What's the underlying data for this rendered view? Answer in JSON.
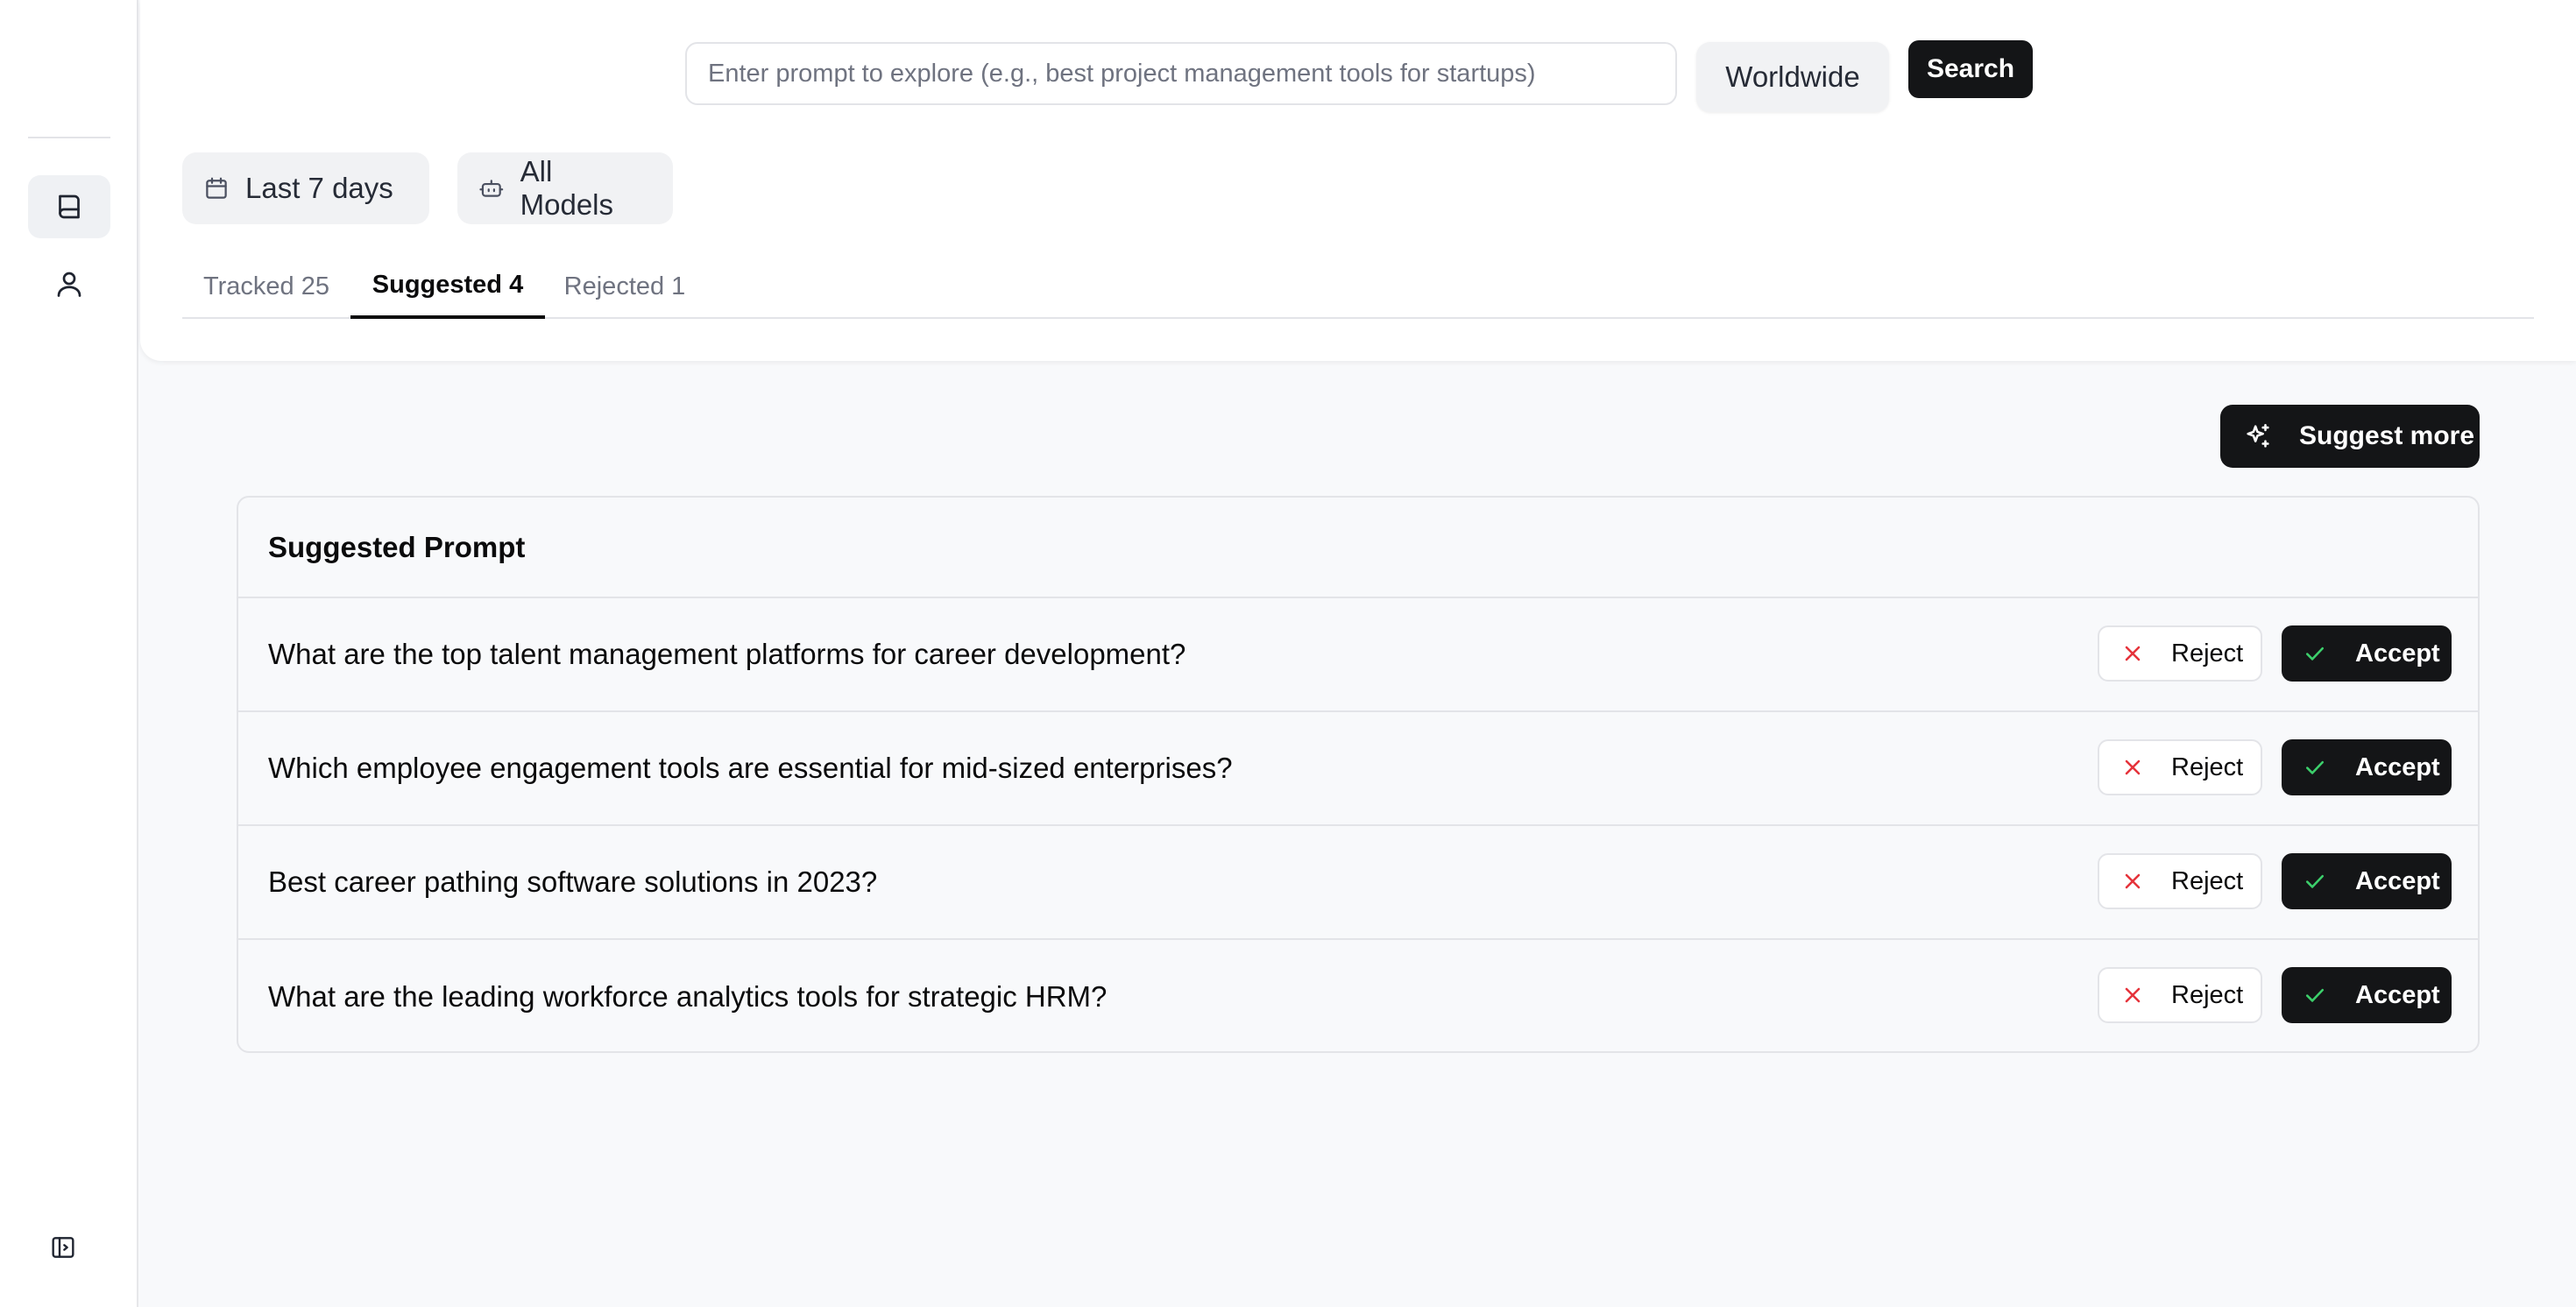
{
  "search": {
    "placeholder": "Enter prompt to explore (e.g., best project management tools for startups)",
    "region": "Worldwide",
    "button_label": "Search"
  },
  "filters": {
    "date_range": "Last 7 days",
    "models": "All Models"
  },
  "tabs": [
    {
      "label": "Tracked 25",
      "active": false
    },
    {
      "label": "Suggested 4",
      "active": true
    },
    {
      "label": "Rejected 1",
      "active": false
    }
  ],
  "actions": {
    "suggest_more": "Suggest more"
  },
  "table": {
    "header": "Suggested Prompt",
    "reject_label": "Reject",
    "accept_label": "Accept",
    "rows": [
      {
        "prompt": "What are the top talent management platforms for career development?"
      },
      {
        "prompt": "Which employee engagement tools are essential for mid-sized enterprises?"
      },
      {
        "prompt": "Best career pathing software solutions in 2023?"
      },
      {
        "prompt": "What are the leading workforce analytics tools for strategic HRM?"
      }
    ]
  },
  "colors": {
    "primary_dark": "#141517",
    "reject_red": "#e5333b",
    "accept_green": "#3ccf6b",
    "muted_text": "#6f7380"
  },
  "icons": {
    "sidebar": [
      "book-icon",
      "user-icon",
      "sidebar-toggle-icon"
    ],
    "filters": [
      "calendar-icon",
      "bot-icon"
    ],
    "suggest": "sparkles-icon",
    "reject": "x-icon",
    "accept": "check-icon"
  }
}
